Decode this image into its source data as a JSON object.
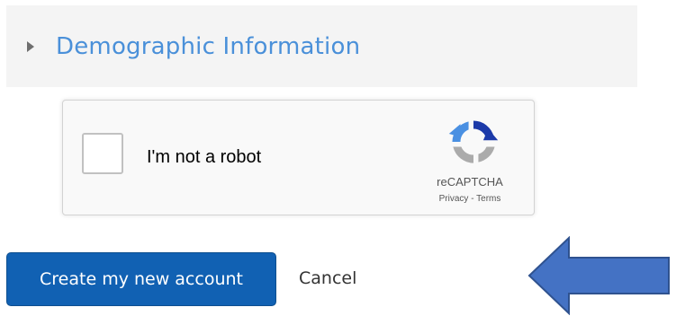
{
  "section": {
    "title": "Demographic Information",
    "caret_icon": "caret-right-icon",
    "title_color": "#4a90d9"
  },
  "recaptcha": {
    "label": "I'm not a robot",
    "brand": "reCAPTCHA",
    "privacy_link": "Privacy",
    "separator": " - ",
    "terms_link": "Terms",
    "logo_icon": "recaptcha-logo-icon",
    "checked": false
  },
  "actions": {
    "create_label": "Create my new account",
    "cancel_label": "Cancel",
    "primary_color": "#1161b3"
  },
  "annotation": {
    "icon": "left-arrow-icon",
    "color": "#4472c4"
  }
}
